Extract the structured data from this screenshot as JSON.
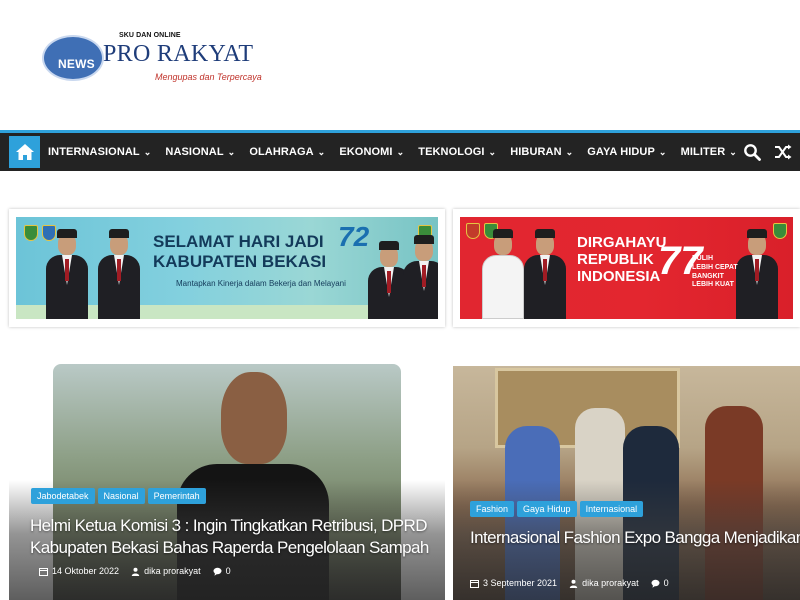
{
  "logo": {
    "badge": "NEWS",
    "pretitle": "SKU DAN ONLINE",
    "name": "PRO RAKYAT",
    "tagline": "Mengupas dan Terpercaya"
  },
  "nav": {
    "items": [
      {
        "label": "INTERNASIONAL"
      },
      {
        "label": "NASIONAL"
      },
      {
        "label": "OLAHRAGA"
      },
      {
        "label": "EKONOMI"
      },
      {
        "label": "TEKNOLOGI"
      },
      {
        "label": "HIBURAN"
      },
      {
        "label": "GAYA HIDUP"
      },
      {
        "label": "MILITER"
      }
    ],
    "accent": "#2ea1db",
    "background": "#232323"
  },
  "ads": {
    "left": {
      "title_line1": "SELAMAT HARI JADI",
      "title_line2": "KABUPATEN BEKASI",
      "subtitle": "Mantapkan Kinerja dalam Bekerja dan Melayani",
      "number": "72"
    },
    "right": {
      "title_line1": "DIRGAHAYU",
      "title_line2": "REPUBLIK",
      "title_line3": "INDONESIA",
      "number": "77",
      "tagline": "PULIH\nLEBIH CEPAT\nBANGKIT\nLEBIH KUAT"
    }
  },
  "articles": [
    {
      "categories": [
        "Jabodetabek",
        "Nasional",
        "Pemerintah"
      ],
      "title": "Helmi Ketua Komisi 3 : Ingin Tingkatkan Retribusi, DPRD Kabupaten Bekasi Bahas Raperda Pengelolaan Sampah",
      "date": "14 Oktober 2022",
      "author": "dika prorakyat",
      "comments": "0"
    },
    {
      "categories": [
        "Fashion",
        "Gaya Hidup",
        "Internasional"
      ],
      "title": "Internasional Fashion Expo Bangga Menjadikan KBRI Itali Sebagai Salah Satu Mitra",
      "date": "3 September 2021",
      "author": "dika prorakyat",
      "comments": "0"
    }
  ]
}
